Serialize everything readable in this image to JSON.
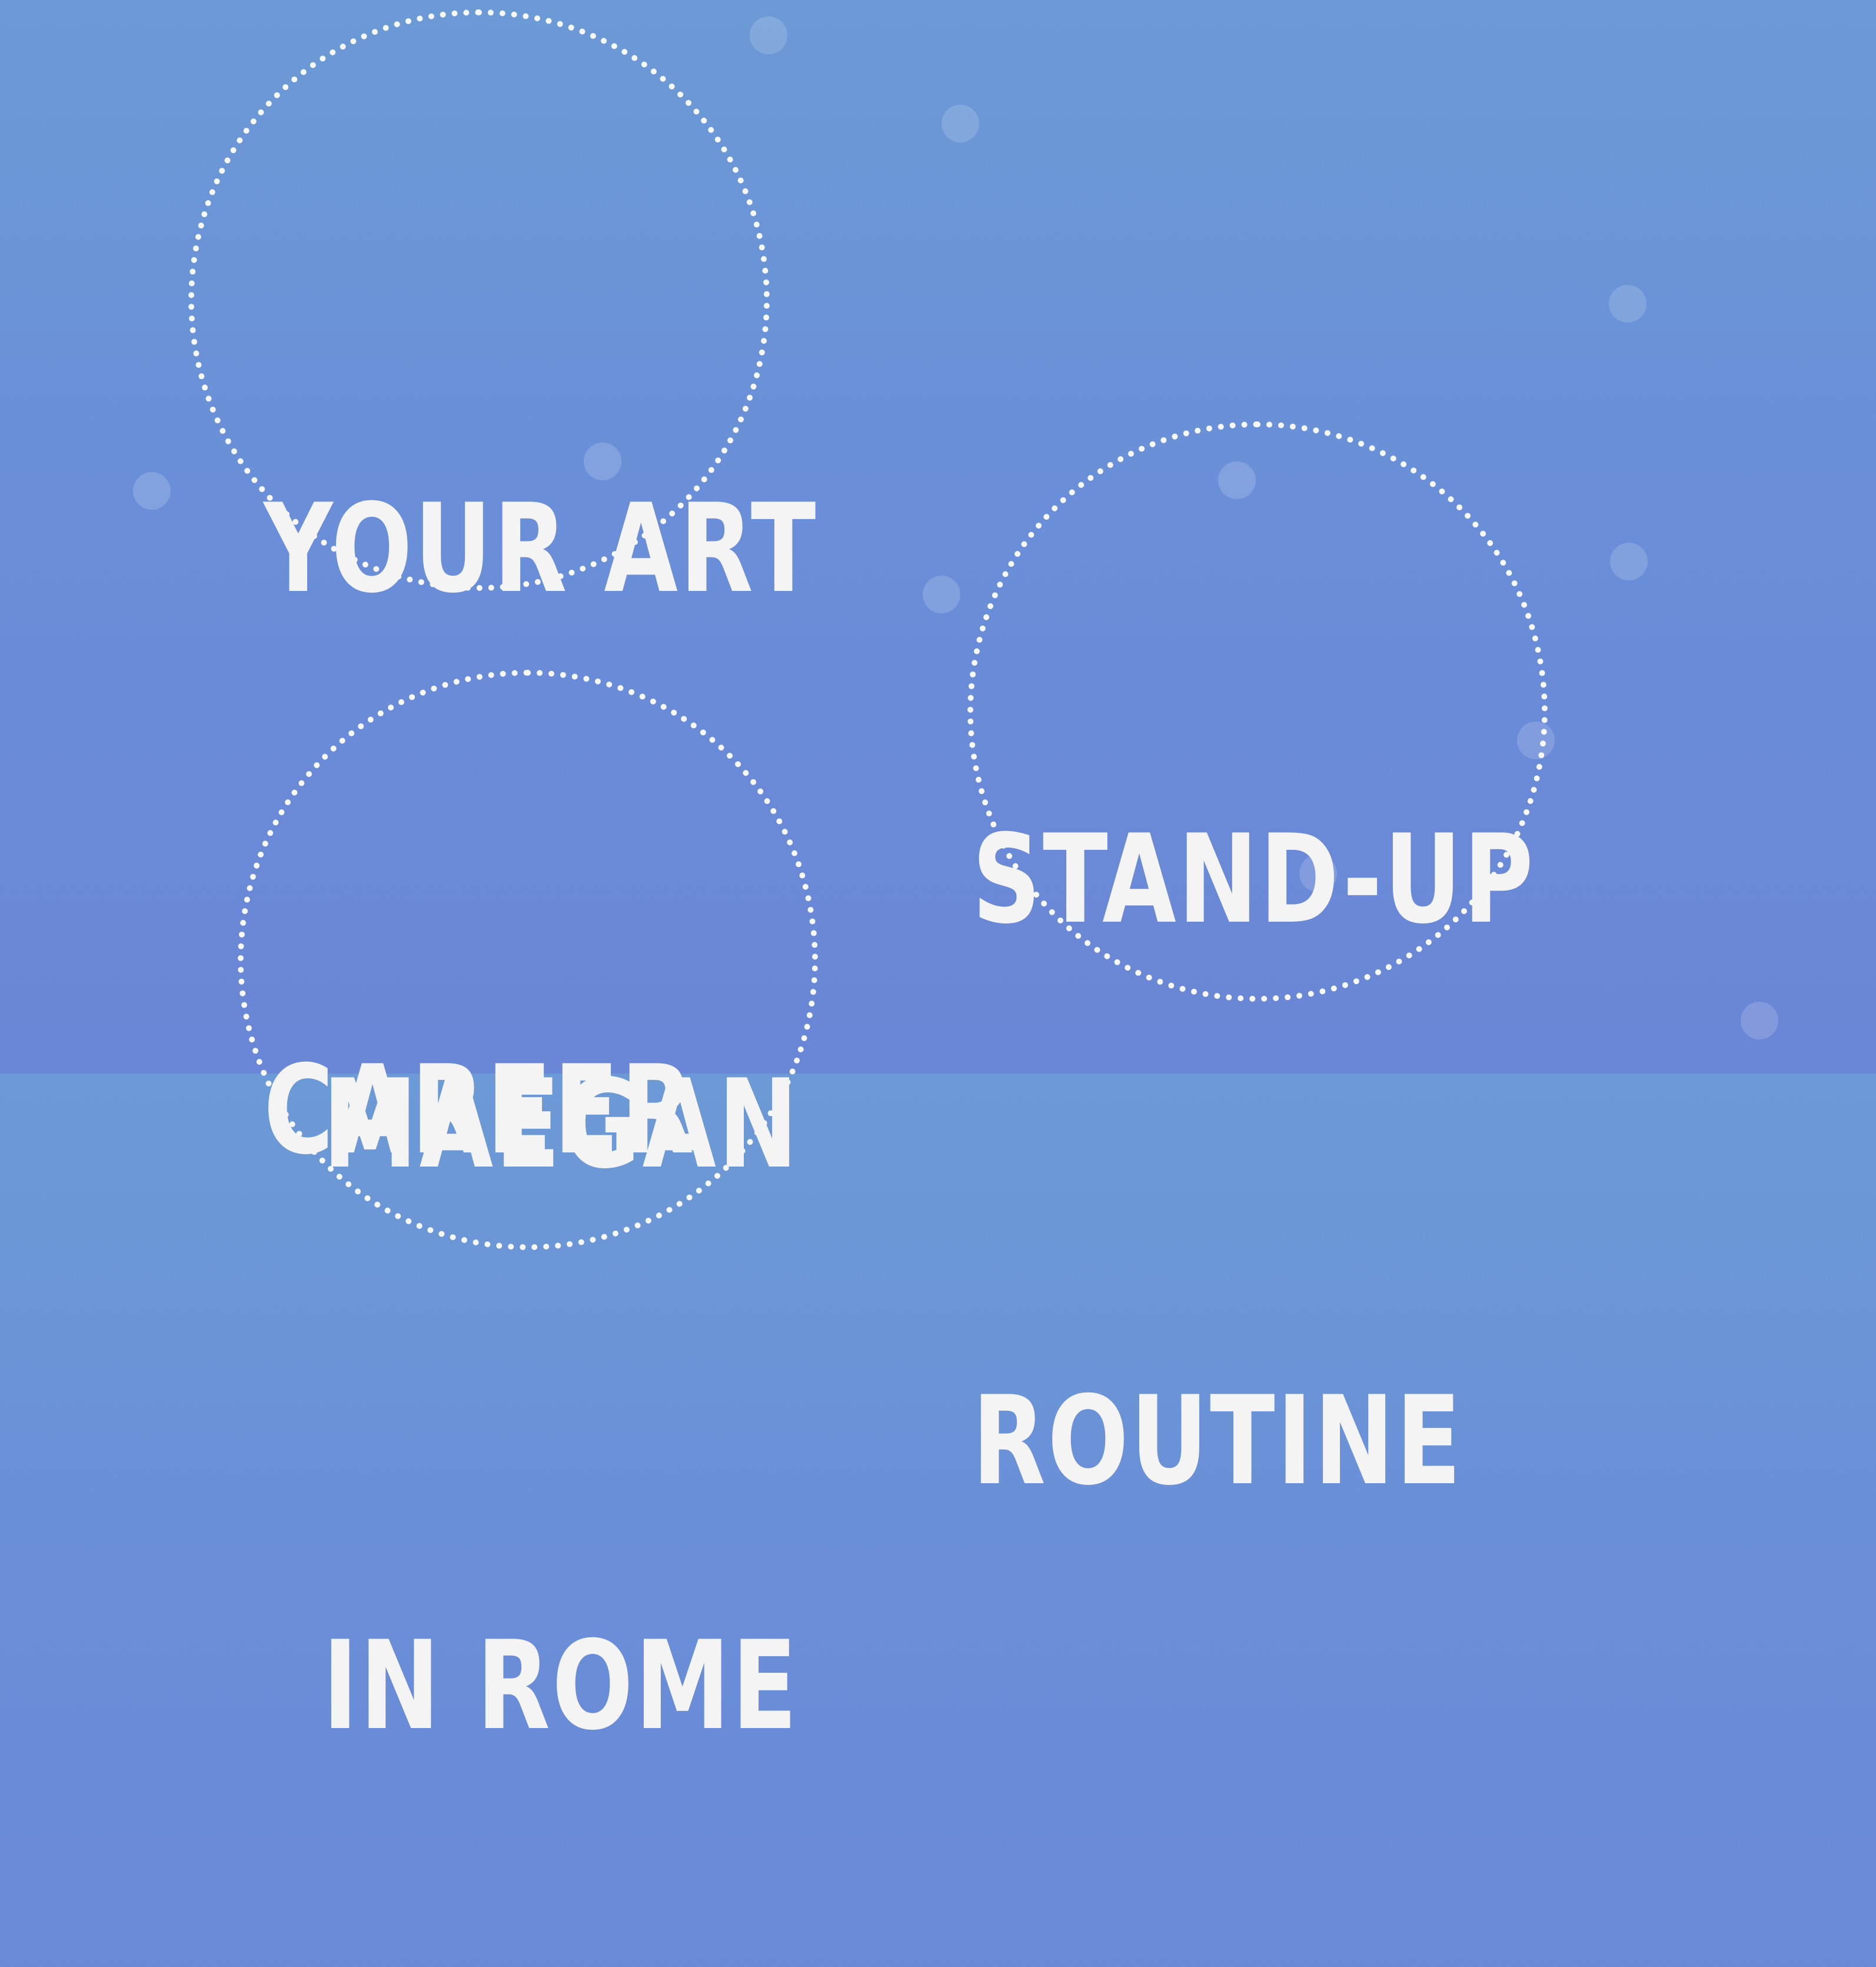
{
  "topics": [
    {
      "line1": "YOUR ART",
      "line2": "CAREER"
    },
    {
      "line1": "STAND-UP",
      "line2": "ROUTINE"
    },
    {
      "line1": "MAEGAN",
      "line2": "IN ROME"
    }
  ]
}
